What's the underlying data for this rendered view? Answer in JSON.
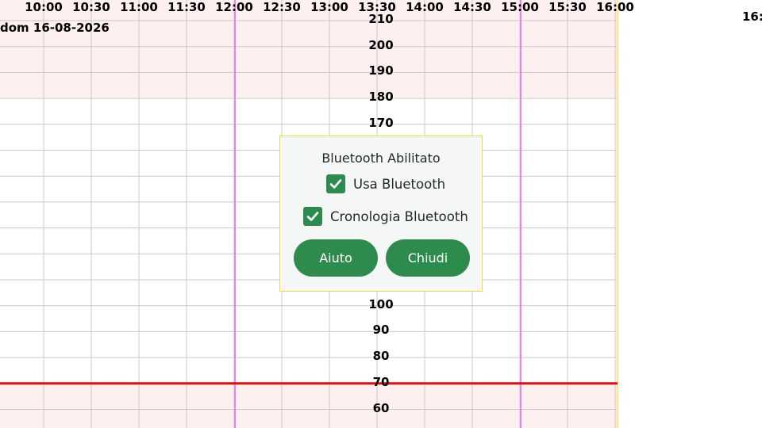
{
  "graph": {
    "date": "dom 16-08-2026",
    "time_labels": [
      "10:00",
      "10:30",
      "11:00",
      "11:30",
      "12:00",
      "12:30",
      "13:00",
      "13:30",
      "14:00",
      "14:30",
      "15:00",
      "15:30",
      "16:00"
    ],
    "time_label_right": "16:",
    "y_labels_upper": [
      "210",
      "200",
      "190",
      "180",
      "170"
    ],
    "y_labels_lower": [
      "100",
      "90",
      "80",
      "70",
      "60"
    ],
    "colors": {
      "high_zone": "#fff0f0",
      "grid": "#c8c8c8",
      "marker_line": "#f080f0",
      "target_line": "#e01010",
      "edge_line": "#f5e9a8"
    }
  },
  "dialog": {
    "title": "Bluetooth Abilitato",
    "use_bluetooth_label": "Usa Bluetooth",
    "use_bluetooth_checked": true,
    "history_label": "Cronologia Bluetooth",
    "history_checked": true,
    "help_button": "Aiuto",
    "close_button": "Chiudi",
    "accent_color": "#2e8b4e",
    "border_color": "#e6e02e"
  }
}
